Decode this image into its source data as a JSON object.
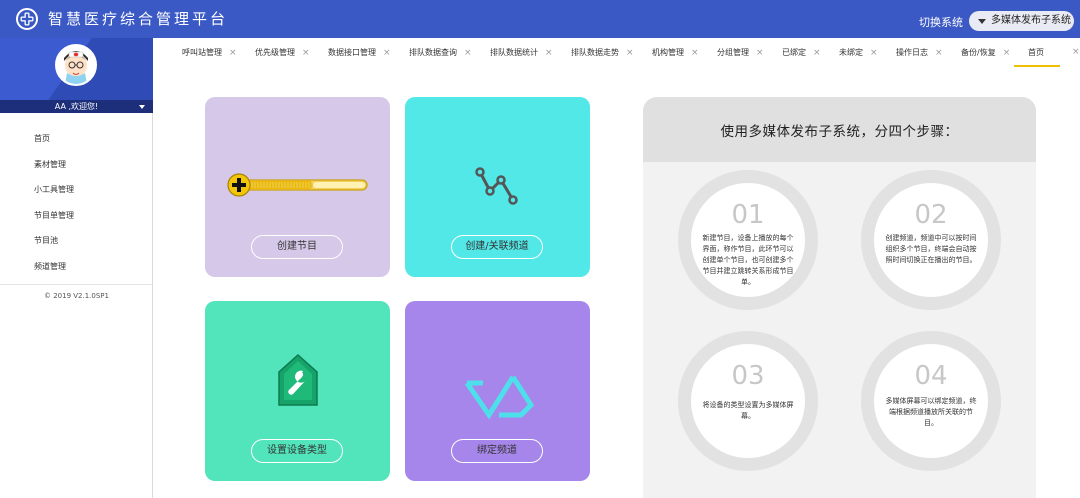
{
  "header": {
    "title": "智慧医疗综合管理平台",
    "switch_label": "切换系统",
    "switch_value": "多媒体发布子系统"
  },
  "user": {
    "greeting": "AA ,欢迎您!"
  },
  "sidebar": {
    "items": [
      {
        "label": "首页"
      },
      {
        "label": "素材管理"
      },
      {
        "label": "小工具管理"
      },
      {
        "label": "节目单管理"
      },
      {
        "label": "节目池"
      },
      {
        "label": "频道管理"
      }
    ],
    "version": "© 2019 V2.1.0SP1"
  },
  "tabs": [
    {
      "label": "呼叫站管理",
      "close": "×"
    },
    {
      "label": "优先级管理",
      "close": "×"
    },
    {
      "label": "数据接口管理",
      "close": "×"
    },
    {
      "label": "排队数据查询",
      "close": "×"
    },
    {
      "label": "排队数据统计",
      "close": "×"
    },
    {
      "label": "排队数据走势",
      "close": "×"
    },
    {
      "label": "机构管理",
      "close": "×"
    },
    {
      "label": "分组管理",
      "close": "×"
    },
    {
      "label": "已绑定",
      "close": "×"
    },
    {
      "label": "未绑定",
      "close": "×"
    },
    {
      "label": "操作日志",
      "close": "×"
    },
    {
      "label": "备份/恢复",
      "close": "×"
    },
    {
      "label": "首页",
      "close": "×",
      "active": true
    }
  ],
  "cards": [
    {
      "label": "创建节目",
      "color": "#d6c8e8",
      "icon": "progress-plus-icon"
    },
    {
      "label": "创建/关联频道",
      "color": "#53e8e8",
      "icon": "channel-link-icon"
    },
    {
      "label": "设置设备类型",
      "color": "#52e4bb",
      "icon": "device-wrench-icon"
    },
    {
      "label": "绑定频道",
      "color": "#a786ec",
      "icon": "bind-chevron-icon"
    }
  ],
  "steps": {
    "title": "使用多媒体发布子系统，分四个步骤：",
    "items": [
      {
        "num": "01",
        "desc": "新建节目，设备上播放的每个界面，称作节目，此环节可以创建单个节目，也可创建多个节目并建立跳转关系形成节目单。"
      },
      {
        "num": "02",
        "desc": "创建频道，频道中可以按时间组织多个节目，终端会自动按照时间切换正在播出的节目。"
      },
      {
        "num": "03",
        "desc": "将设备的类型设置为多媒体屏幕。"
      },
      {
        "num": "04",
        "desc": "多媒体屏幕可以绑定频道，终端根据频道播放所关联的节目。"
      }
    ]
  },
  "colors": {
    "header": "#3b59c5",
    "sidebar_user": "#3c5bd0",
    "active_tab": "#f0c000"
  }
}
